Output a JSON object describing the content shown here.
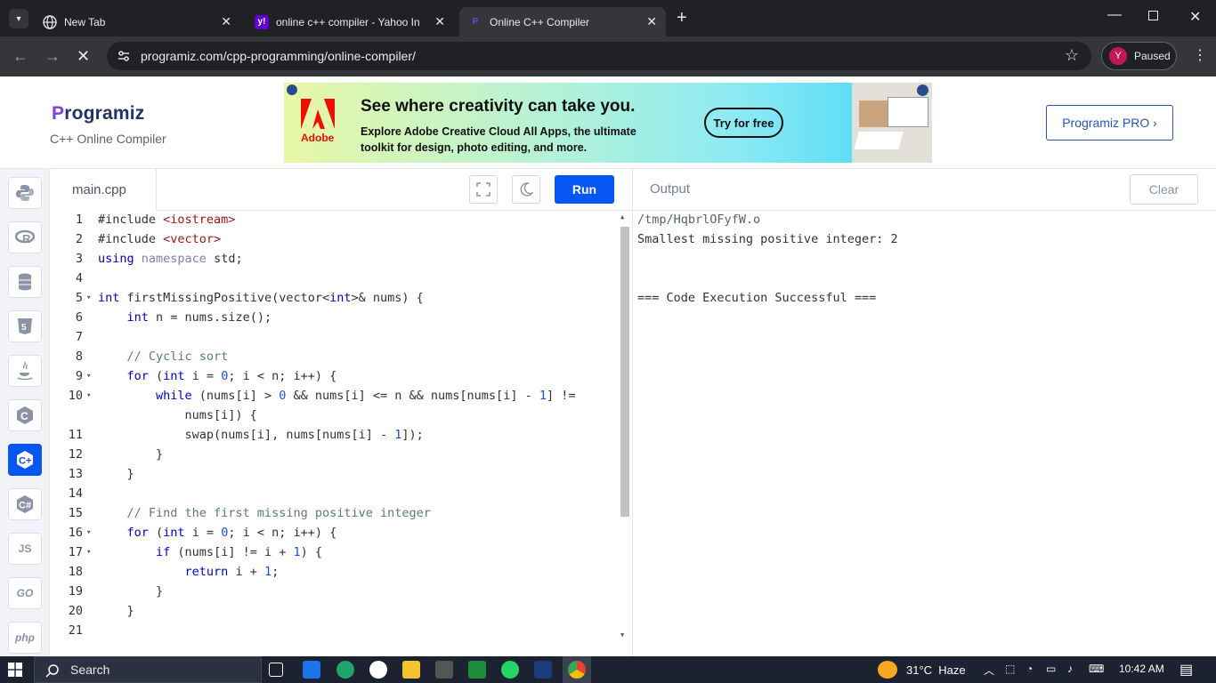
{
  "browser": {
    "tabs": [
      {
        "title": "New Tab",
        "icon": "globe-icon"
      },
      {
        "title": "online c++ compiler - Yahoo In",
        "icon": "yahoo-icon"
      },
      {
        "title": "Online C++ Compiler",
        "icon": "programiz-icon"
      }
    ],
    "url": "programiz.com/cpp-programming/online-compiler/",
    "profile_initial": "Y",
    "profile_status": "Paused"
  },
  "site": {
    "logo": "Programiz",
    "logo_first": "P",
    "logo_rest": "rogramiz",
    "subtitle": "C++ Online Compiler",
    "pro_button": "Programiz PRO ›"
  },
  "ad": {
    "brand": "Adobe",
    "title": "See where creativity can take you.",
    "text": "Explore Adobe Creative Cloud All Apps, the ultimate toolkit for design, photo editing, and more.",
    "cta": "Try for free"
  },
  "languages": [
    "python",
    "r",
    "sql",
    "html",
    "java",
    "c",
    "cpp",
    "csharp",
    "js",
    "go",
    "php"
  ],
  "lang_labels": {
    "js": "JS",
    "go": "GO",
    "php": "php"
  },
  "editor": {
    "filename": "main.cpp",
    "run_label": "Run",
    "lines": [
      {
        "n": "1",
        "fold": false
      },
      {
        "n": "2",
        "fold": false
      },
      {
        "n": "3",
        "fold": false
      },
      {
        "n": "4",
        "fold": false
      },
      {
        "n": "5",
        "fold": true
      },
      {
        "n": "6",
        "fold": false
      },
      {
        "n": "7",
        "fold": false
      },
      {
        "n": "8",
        "fold": false
      },
      {
        "n": "9",
        "fold": true
      },
      {
        "n": "10",
        "fold": true
      },
      {
        "n": "11",
        "fold": false
      },
      {
        "n": "12",
        "fold": false
      },
      {
        "n": "13",
        "fold": false
      },
      {
        "n": "14",
        "fold": false
      },
      {
        "n": "15",
        "fold": false
      },
      {
        "n": "16",
        "fold": true
      },
      {
        "n": "17",
        "fold": true
      },
      {
        "n": "18",
        "fold": false
      },
      {
        "n": "19",
        "fold": false
      },
      {
        "n": "20",
        "fold": false
      },
      {
        "n": "21",
        "fold": false
      }
    ],
    "code": [
      "#include <iostream>",
      "#include <vector>",
      "using namespace std;",
      "",
      "int firstMissingPositive(vector<int>& nums) {",
      "    int n = nums.size();",
      "",
      "    // Cyclic sort",
      "    for (int i = 0; i < n; i++) {",
      "        while (nums[i] > 0 && nums[i] <= n && nums[nums[i] - 1] !=",
      "            nums[i]) {",
      "            swap(nums[i], nums[nums[i] - 1]);",
      "        }",
      "    }",
      "",
      "    // Find the first missing positive integer",
      "    for (int i = 0; i < n; i++) {",
      "        if (nums[i] != i + 1) {",
      "            return i + 1;",
      "        }",
      "    }",
      ""
    ]
  },
  "output": {
    "title": "Output",
    "clear_label": "Clear",
    "lines": [
      "/tmp/HqbrlOFyfW.o",
      "Smallest missing positive integer: 2",
      "",
      "",
      "=== Code Execution Successful ==="
    ]
  },
  "taskbar": {
    "search_placeholder": "Search",
    "weather": "31°C  Haze",
    "time": "10:42 AM",
    "apps": [
      "task-view",
      "mail",
      "edge",
      "github",
      "file-explorer",
      "store",
      "sheets",
      "whatsapp",
      "devc",
      "chrome"
    ]
  },
  "colors": {
    "accent": "#0556f3",
    "keyword": "#0000c8",
    "string": "#a31515",
    "comment": "#5b7a86"
  }
}
